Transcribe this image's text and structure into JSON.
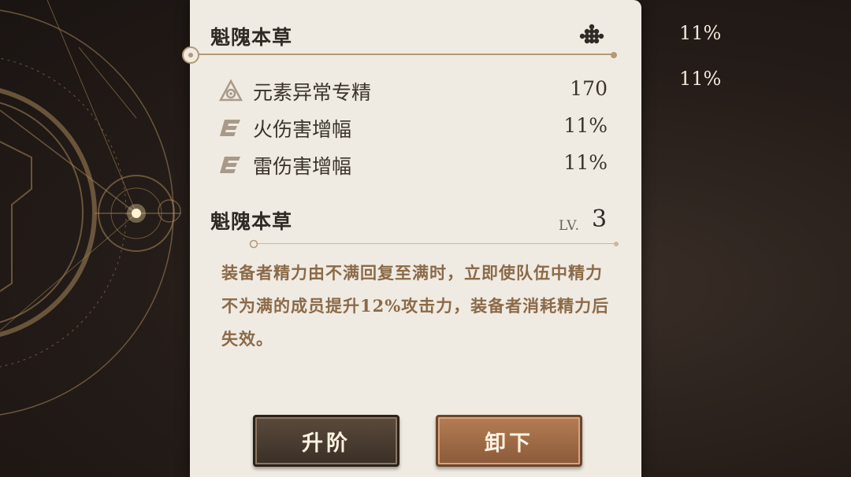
{
  "header": {
    "title": "魁隗本草",
    "set_icon": "flower-cluster-icon"
  },
  "stats": [
    {
      "icon": "elemental-mastery-icon",
      "label": "元素异常专精",
      "value": "170"
    },
    {
      "icon": "damage-bonus-icon",
      "label": "火伤害增幅",
      "value": "11%"
    },
    {
      "icon": "damage-bonus-icon",
      "label": "雷伤害增幅",
      "value": "11%"
    }
  ],
  "item": {
    "name": "魁隗本草",
    "level_label": "LV.",
    "level": "3",
    "description": "装备者精力由不满回复至满时，立即使队伍中精力不为满的成员提升12%攻击力，装备者消耗精力后失效。"
  },
  "buttons": {
    "upgrade": "升阶",
    "unequip": "卸下"
  },
  "background_stats": [
    "11%",
    "11%"
  ],
  "colors": {
    "panel_bg": "#f0ebe2",
    "accent_line": "#b49878",
    "description_text": "#8a6a48",
    "unequip_button": "#a06c47",
    "upgrade_button": "#4a3c30"
  }
}
